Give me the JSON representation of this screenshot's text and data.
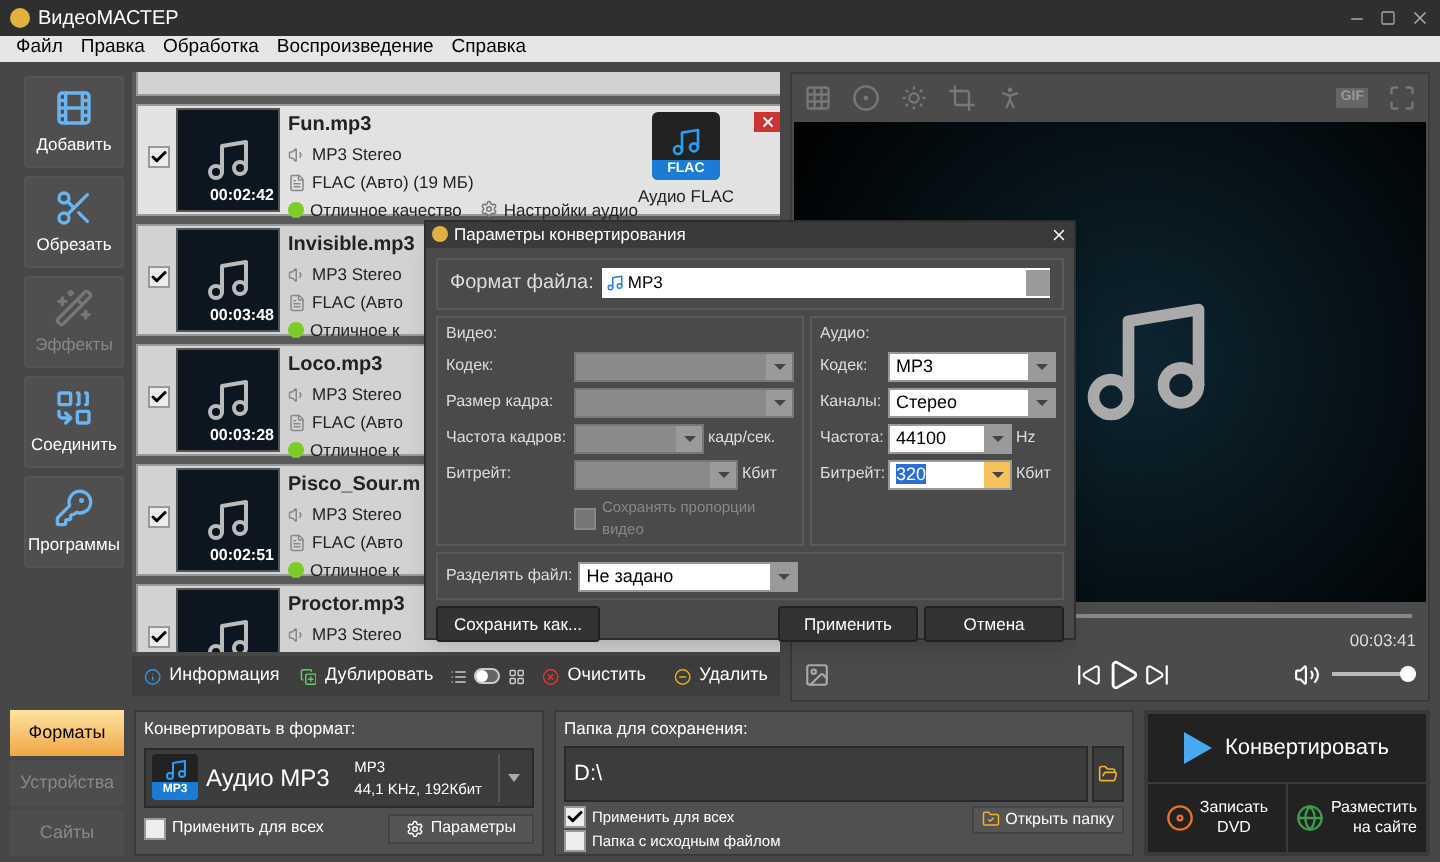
{
  "window": {
    "title": "ВидеоМАСТЕР"
  },
  "menu": [
    "Файл",
    "Правка",
    "Обработка",
    "Воспроизведение",
    "Справка"
  ],
  "sidebar": [
    {
      "label": "Добавить",
      "kind": "add",
      "disabled": false
    },
    {
      "label": "Обрезать",
      "kind": "cut",
      "disabled": false
    },
    {
      "label": "Эффекты",
      "kind": "effects",
      "disabled": true
    },
    {
      "label": "Соединить",
      "kind": "join",
      "disabled": false
    },
    {
      "label": "Программы",
      "kind": "programs",
      "disabled": false
    }
  ],
  "files": [
    {
      "name": "Fun.mp3",
      "source": "MP3 Stereo",
      "output": "FLAC (Авто) (19 МБ)",
      "duration": "00:02:42",
      "quality": "Отличное качество",
      "settings": "Настройки аудио",
      "format_badge": "FLAC",
      "format_label": "Аудио FLAC",
      "checked": true,
      "hovered": true
    },
    {
      "name": "Invisible.mp3",
      "source": "MP3 Stereo",
      "output": "FLAC (Авто",
      "duration": "00:03:48",
      "quality": "Отличное к",
      "checked": true,
      "hovered": false
    },
    {
      "name": "Loco.mp3",
      "source": "MP3 Stereo",
      "output": "FLAC (Авто",
      "duration": "00:03:28",
      "quality": "Отличное к",
      "checked": true,
      "hovered": false
    },
    {
      "name": "Pisco_Sour.m",
      "source": "MP3 Stereo",
      "output": "FLAC (Авто",
      "duration": "00:02:51",
      "quality": "Отличное к",
      "checked": true,
      "hovered": false
    },
    {
      "name": "Proctor.mp3",
      "source": "MP3 Stereo",
      "checked": true,
      "hovered": false
    }
  ],
  "list_toolbar": {
    "info": "Информация",
    "duplicate": "Дублировать",
    "view_toggle": {
      "on": false
    },
    "clear": "Очистить",
    "delete": "Удалить"
  },
  "preview": {
    "gif": "GIF",
    "time": "00:03:41",
    "volume": {
      "level": 1
    }
  },
  "bottom": {
    "tabs": [
      {
        "label": "Форматы",
        "selected": true
      },
      {
        "label": "Устройства",
        "selected": false
      },
      {
        "label": "Сайты",
        "selected": false
      }
    ],
    "format_title": "Конвертировать в формат:",
    "format_icon": "MP3",
    "format_name": "Аудио MP3",
    "format_codec": "MP3",
    "format_specs": "44,1 KHz, 192Кбит",
    "apply_all": {
      "label": "Применить для всех",
      "checked": false
    },
    "params": "Параметры",
    "folder_title": "Папка для сохранения:",
    "folder": "D:\\",
    "folder_options": [
      {
        "label": "Применить для всех",
        "checked": true
      },
      {
        "label": "Папка с исходным файлом",
        "checked": false
      }
    ],
    "open_folder": "Открыть папку",
    "convert": "Конвертировать",
    "burn": [
      "Записать",
      "DVD"
    ],
    "publish": [
      "Разместить",
      "на сайте"
    ]
  },
  "dialog": {
    "title": "Параметры конвертирования",
    "format_label": "Формат файла:",
    "format": "MP3",
    "video_title": "Видео:",
    "video": [
      {
        "label": "Кодек:",
        "disabled": true
      },
      {
        "label": "Размер кадра:",
        "disabled": true
      },
      {
        "label": "Частота кадров:",
        "unit": "кадр/сек.",
        "disabled": true
      },
      {
        "label": "Битрейт:",
        "unit": "Кбит",
        "disabled": true
      }
    ],
    "keep_ratio": {
      "label": "Сохранять пропорции видео",
      "checked": false,
      "disabled": true
    },
    "audio_title": "Аудио:",
    "audio": [
      {
        "label": "Кодек:",
        "value": "MP3",
        "focused": false
      },
      {
        "label": "Каналы:",
        "value": "Стерео",
        "focused": false
      },
      {
        "label": "Частота:",
        "value": "44100",
        "unit": "Hz",
        "focused": false
      },
      {
        "label": "Битрейт:",
        "value": "320",
        "unit": "Кбит",
        "focused": true
      }
    ],
    "split_label": "Разделять файл:",
    "split": "Не задано",
    "buttons": [
      "Сохранить как...",
      "Применить",
      "Отмена"
    ]
  }
}
